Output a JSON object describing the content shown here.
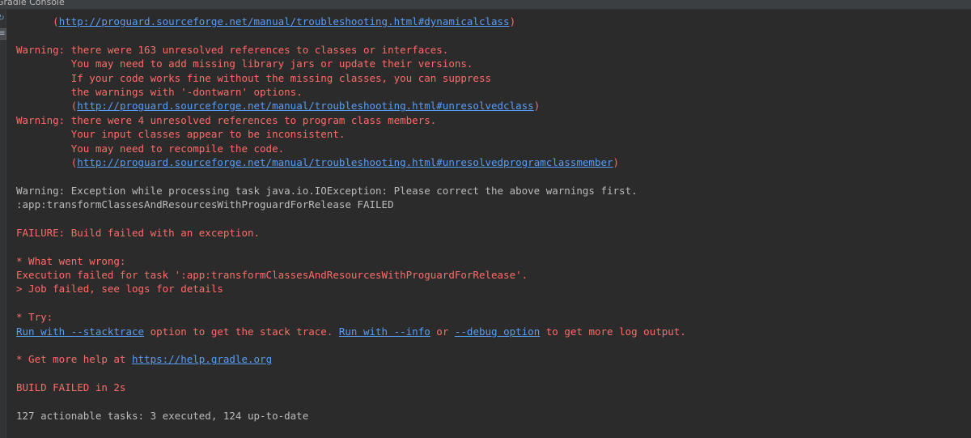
{
  "window": {
    "title": "Gradle Console"
  },
  "console": {
    "lines": [
      {
        "parts": [
          {
            "t": "      (",
            "c": "err"
          },
          {
            "t": "http://proguard.sourceforge.net/manual/troubleshooting.html#dynamicalclass",
            "c": "link"
          },
          {
            "t": ")",
            "c": "err"
          }
        ]
      },
      {
        "parts": [
          {
            "t": "",
            "c": "norm"
          }
        ]
      },
      {
        "parts": [
          {
            "t": "Warning: there were 163 unresolved references to classes or interfaces.",
            "c": "err"
          }
        ]
      },
      {
        "parts": [
          {
            "t": "         You may need to add missing library jars or update their versions.",
            "c": "err"
          }
        ]
      },
      {
        "parts": [
          {
            "t": "         If your code works fine without the missing classes, you can suppress",
            "c": "err"
          }
        ]
      },
      {
        "parts": [
          {
            "t": "         the warnings with '-dontwarn' options.",
            "c": "err"
          }
        ]
      },
      {
        "parts": [
          {
            "t": "         (",
            "c": "err"
          },
          {
            "t": "http://proguard.sourceforge.net/manual/troubleshooting.html#unresolvedclass",
            "c": "link"
          },
          {
            "t": ")",
            "c": "err"
          }
        ]
      },
      {
        "parts": [
          {
            "t": "Warning: there were 4 unresolved references to program class members.",
            "c": "err"
          }
        ]
      },
      {
        "parts": [
          {
            "t": "         Your input classes appear to be inconsistent.",
            "c": "err"
          }
        ]
      },
      {
        "parts": [
          {
            "t": "         You may need to recompile the code.",
            "c": "err"
          }
        ]
      },
      {
        "parts": [
          {
            "t": "         (",
            "c": "err"
          },
          {
            "t": "http://proguard.sourceforge.net/manual/troubleshooting.html#unresolvedprogramclassmember",
            "c": "link"
          },
          {
            "t": ")",
            "c": "err"
          }
        ]
      },
      {
        "parts": [
          {
            "t": "",
            "c": "norm"
          }
        ]
      },
      {
        "parts": [
          {
            "t": "Warning: Exception while processing task java.io.IOException: Please correct the above warnings first.",
            "c": "norm"
          }
        ]
      },
      {
        "parts": [
          {
            "t": ":app:transformClassesAndResourcesWithProguardForRelease FAILED",
            "c": "norm"
          }
        ]
      },
      {
        "parts": [
          {
            "t": "",
            "c": "norm"
          }
        ]
      },
      {
        "parts": [
          {
            "t": "FAILURE: Build failed with an exception.",
            "c": "err"
          }
        ]
      },
      {
        "parts": [
          {
            "t": "",
            "c": "norm"
          }
        ]
      },
      {
        "parts": [
          {
            "t": "* What went wrong:",
            "c": "err"
          }
        ]
      },
      {
        "parts": [
          {
            "t": "Execution failed for task ':app:transformClassesAndResourcesWithProguardForRelease'.",
            "c": "err"
          }
        ]
      },
      {
        "parts": [
          {
            "t": "> Job failed, see logs for details",
            "c": "err"
          }
        ]
      },
      {
        "parts": [
          {
            "t": "",
            "c": "norm"
          }
        ]
      },
      {
        "parts": [
          {
            "t": "* Try:",
            "c": "err"
          }
        ]
      },
      {
        "parts": [
          {
            "t": "Run with --stacktrace",
            "c": "link"
          },
          {
            "t": " option to get the stack trace. ",
            "c": "err"
          },
          {
            "t": "Run with --info",
            "c": "link"
          },
          {
            "t": " or ",
            "c": "err"
          },
          {
            "t": "--debug option",
            "c": "link"
          },
          {
            "t": " to get more log output.",
            "c": "err"
          }
        ]
      },
      {
        "parts": [
          {
            "t": "",
            "c": "norm"
          }
        ]
      },
      {
        "parts": [
          {
            "t": "* Get more help at ",
            "c": "err"
          },
          {
            "t": "https://help.gradle.org",
            "c": "link"
          }
        ]
      },
      {
        "parts": [
          {
            "t": "",
            "c": "norm"
          }
        ]
      },
      {
        "parts": [
          {
            "t": "BUILD FAILED in 2s",
            "c": "err"
          }
        ]
      },
      {
        "parts": [
          {
            "t": "",
            "c": "norm"
          }
        ]
      },
      {
        "parts": [
          {
            "t": "127 actionable tasks: 3 executed, 124 up-to-date",
            "c": "norm"
          }
        ]
      }
    ]
  },
  "colors": {
    "error": "#ff6b68",
    "normal": "#bbbbbb",
    "link": "#589df6",
    "background": "#2b2b2b"
  },
  "gutter": {
    "icon1": "rerun-icon",
    "icon2": "toggle-view-icon"
  }
}
